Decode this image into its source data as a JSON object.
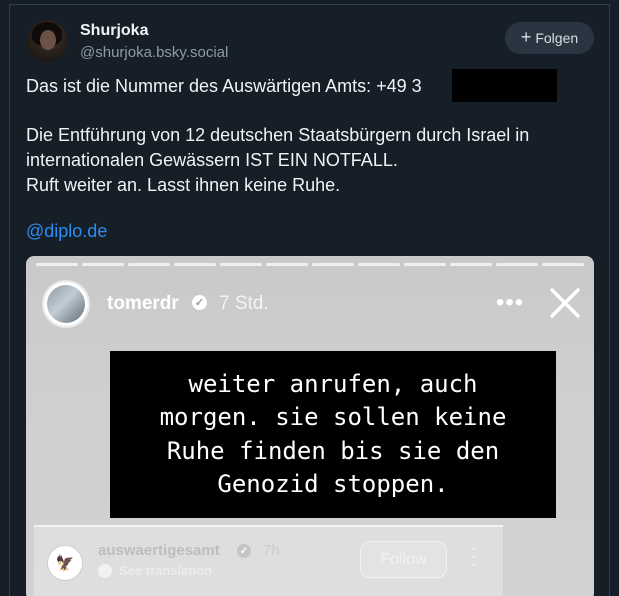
{
  "post": {
    "author": {
      "display_name": "Shurjoka",
      "handle": "@shurjoka.bsky.social"
    },
    "follow_button": {
      "label": "Folgen",
      "icon": "plus-icon"
    },
    "text_lines": [
      "Das ist die Nummer des Auswärtigen Amts: +49 3",
      "Die Entführung von 12 deutschen Staatsbürgern durch Israel in",
      "internationalen Gewässern IST EIN NOTFALL.",
      "Ruft weiter an. Lasst ihnen keine Ruhe."
    ],
    "mention": "@diplo.de"
  },
  "story": {
    "progress_segments": 12,
    "username": "tomerdr",
    "time": "7 Std.",
    "icons": [
      "verified-icon",
      "more-icon",
      "close-icon"
    ],
    "quote_lines": [
      "weiter anrufen, auch",
      "morgen. sie sollen keine",
      "Ruhe finden bis sie den",
      "Genozid stoppen."
    ],
    "shared_post": {
      "username": "auswaertigesamt",
      "time": "7h",
      "translate_label": "See translation",
      "follow_label": "Follow",
      "icons": [
        "eagle-icon",
        "verified-icon",
        "globe-icon",
        "more-vertical-icon"
      ]
    }
  },
  "colors": {
    "background": "#161e27",
    "link": "#2d8cf0",
    "follow_button_bg": "#2a3542"
  }
}
